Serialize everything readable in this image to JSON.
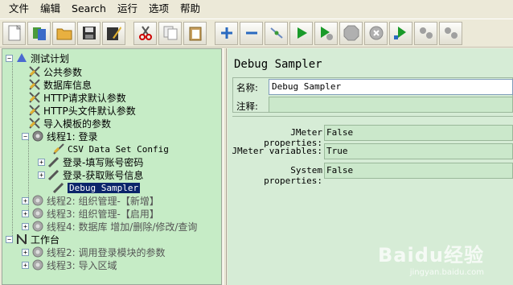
{
  "menu": [
    "文件",
    "编辑",
    "Search",
    "运行",
    "选项",
    "帮助"
  ],
  "toolbar": {
    "buttons": [
      "new-icon",
      "templates-icon",
      "open-icon",
      "save-icon",
      "save-as-icon",
      "cut-icon",
      "copy-icon",
      "paste-icon",
      "expand-icon",
      "collapse-icon",
      "toggle-icon",
      "start-icon",
      "start-no-pause-icon",
      "stop-icon",
      "shutdown-icon",
      "remote-start-icon",
      "remote-stop-icon",
      "remote-shutdown-icon"
    ]
  },
  "tree": {
    "root": "测试计划",
    "items": [
      "公共参数",
      "数据库信息",
      "HTTP请求默认参数",
      "HTTP头文件默认参数",
      "导入模板的参数"
    ],
    "thread1": "线程1: 登录",
    "thread1_children": [
      "CSV Data Set Config",
      "登录-填写账号密码",
      "登录-获取账号信息",
      "Debug Sampler"
    ],
    "thread_groups": [
      "线程2: 组织管理-【新增】",
      "线程3: 组织管理-【启用】",
      "线程4: 数据库 增加/删除/修改/查询"
    ],
    "workbench": "工作台",
    "workbench_children": [
      "线程2: 调用登录模块的参数",
      "线程3: 导入区域"
    ]
  },
  "panel": {
    "title": "Debug Sampler",
    "name_label": "名称:",
    "name_value": "Debug Sampler",
    "comment_label": "注释:",
    "props": [
      {
        "label": "JMeter properties:",
        "value": "False"
      },
      {
        "label": "JMeter variables:",
        "value": "True"
      },
      {
        "label": "System properties:",
        "value": "False"
      }
    ]
  },
  "watermark": {
    "brand": "Baidu经验",
    "url": "jingyan.baidu.com"
  },
  "colors": {
    "tree_bg": "#c6ecc6",
    "panel_bg": "#d6ecd6",
    "selection": "#0a246a"
  }
}
